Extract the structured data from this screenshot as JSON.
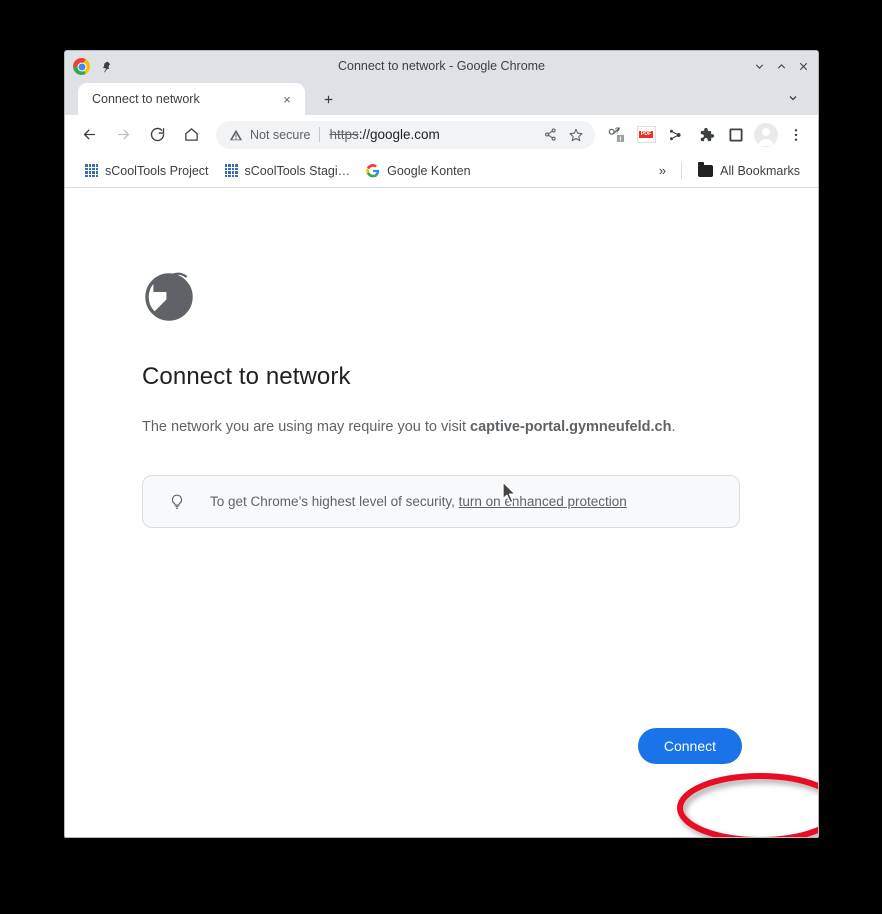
{
  "window": {
    "title": "Connect to network - Google Chrome",
    "controls": {
      "minimize_label": "Minimize",
      "maximize_label": "Maximize",
      "close_label": "Close"
    },
    "pin_label": "Pin"
  },
  "tabs": {
    "items": [
      {
        "title": "Connect to network",
        "close_label": "×"
      }
    ],
    "new_tab_label": "+",
    "tab_search_label": "Search tabs"
  },
  "toolbar": {
    "back_label": "Back",
    "forward_label": "Forward",
    "reload_label": "Reload",
    "home_label": "Home",
    "security_text": "Not secure",
    "url_scheme": "https",
    "url_rest": "://google.com",
    "share_label": "Share",
    "bookmark_label": "Bookmark this tab",
    "extensions": [
      {
        "name": "password-manager-extension-icon"
      },
      {
        "name": "pdf-extension-icon",
        "badge": "PDF"
      },
      {
        "name": "bitwarden-extension-icon"
      },
      {
        "name": "extensions-puzzle-icon"
      }
    ],
    "side_panel_label": "Side panel",
    "profile_label": "Profile",
    "menu_label": "Customize and control Google Chrome"
  },
  "bookmarks": {
    "items": [
      {
        "label": "sCoolTools Project",
        "icon": "grid-icon"
      },
      {
        "label": "sCoolTools Stagi…",
        "icon": "grid-icon"
      },
      {
        "label": "Google Konten",
        "icon": "google-g-icon"
      }
    ],
    "overflow_label": "»",
    "all_bookmarks_label": "All Bookmarks"
  },
  "page": {
    "icon_name": "globe-wifi-icon",
    "heading": "Connect to network",
    "subtitle_prefix": "The network you are using may require you to visit ",
    "subtitle_host": "captive-portal.gymneufeld.ch",
    "subtitle_suffix": ".",
    "notice": {
      "icon_name": "lightbulb-icon",
      "text_prefix": "To get Chrome’s highest level of security, ",
      "link_text": "turn on enhanced protection"
    },
    "connect_button_label": "Connect"
  },
  "annotation": {
    "shape": "ellipse",
    "color": "#e81123",
    "target": "connect-button"
  },
  "colors": {
    "accent_blue": "#1a73e8",
    "chrome_frame": "#dee1e6",
    "omnibox_bg": "#f1f3f4",
    "text_primary": "#202124",
    "text_secondary": "#5f6368",
    "annotation_red": "#e81123",
    "desktop_bg": "#000000"
  }
}
